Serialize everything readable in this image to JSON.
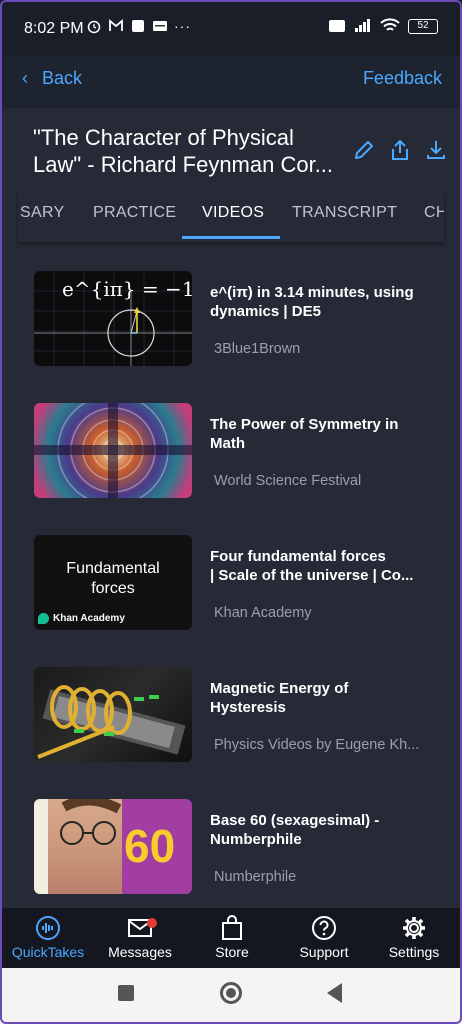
{
  "status": {
    "time": "8:02 PM",
    "battery": "52"
  },
  "header": {
    "back_label": "Back",
    "feedback_label": "Feedback"
  },
  "title": {
    "line1": "\"The Character of Physical",
    "line2": "Law\" - Richard Feynman Cor..."
  },
  "tabs": [
    {
      "label": "SARY"
    },
    {
      "label": "PRACTICE"
    },
    {
      "label": "VIDEOS",
      "active": true
    },
    {
      "label": "TRANSCRIPT"
    },
    {
      "label": "CH"
    }
  ],
  "videos": [
    {
      "title_l1": "e^(iπ) in 3.14 minutes, using",
      "title_l2": "dynamics | DE5",
      "channel": "3Blue1Brown",
      "thumb_text": "e^{iπ} = −1"
    },
    {
      "title_l1": "The Power of Symmetry in",
      "title_l2": "Math",
      "channel": "World Science Festival"
    },
    {
      "title_l1": "Four fundamental forces",
      "title_l2": "| Scale of the universe | Co...",
      "channel": "Khan Academy",
      "thumb_line1": "Fundamental",
      "thumb_line2": "forces",
      "thumb_brand": "Khan Academy"
    },
    {
      "title_l1": "Magnetic Energy of",
      "title_l2": "Hysteresis",
      "channel": "Physics Videos by Eugene Kh..."
    },
    {
      "title_l1": "Base 60 (sexagesimal) -",
      "title_l2": "Numberphile",
      "channel": "Numberphile",
      "thumb_text": "60"
    }
  ],
  "bottom_nav": [
    {
      "label": "QuickTakes",
      "icon": "quicktakes-icon",
      "active": true
    },
    {
      "label": "Messages",
      "icon": "envelope-icon",
      "badge": true
    },
    {
      "label": "Store",
      "icon": "shopping-bag-icon"
    },
    {
      "label": "Support",
      "icon": "help-icon"
    },
    {
      "label": "Settings",
      "icon": "gear-icon"
    }
  ],
  "colors": {
    "accent": "#4aa8ff",
    "background": "#252a36",
    "badge": "#e53935"
  }
}
